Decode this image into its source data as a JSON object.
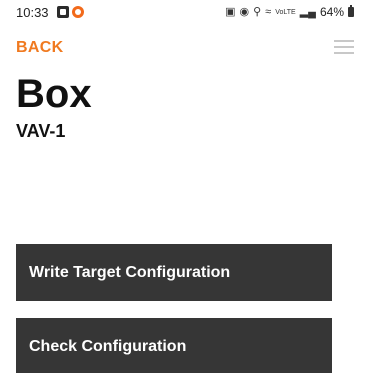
{
  "status_bar": {
    "time": "10:33",
    "battery": "64%",
    "network": "VoLTE",
    "icons": [
      "gallery-notification-icon",
      "app-notification-icon",
      "lock-icon",
      "vibrate-icon",
      "location-icon",
      "wifi-icon",
      "signal-icon",
      "battery-icon"
    ]
  },
  "header": {
    "back_label": "BACK",
    "menu_icon": "hamburger-menu-icon"
  },
  "page": {
    "title": "Box",
    "subtitle": "VAV-1"
  },
  "actions": {
    "write_label": "Write Target Configuration",
    "check_label": "Check Configuration"
  },
  "colors": {
    "accent": "#f07a20",
    "button_bg": "#363636",
    "button_text": "#ffffff",
    "menu_icon": "#c8c8c8"
  }
}
